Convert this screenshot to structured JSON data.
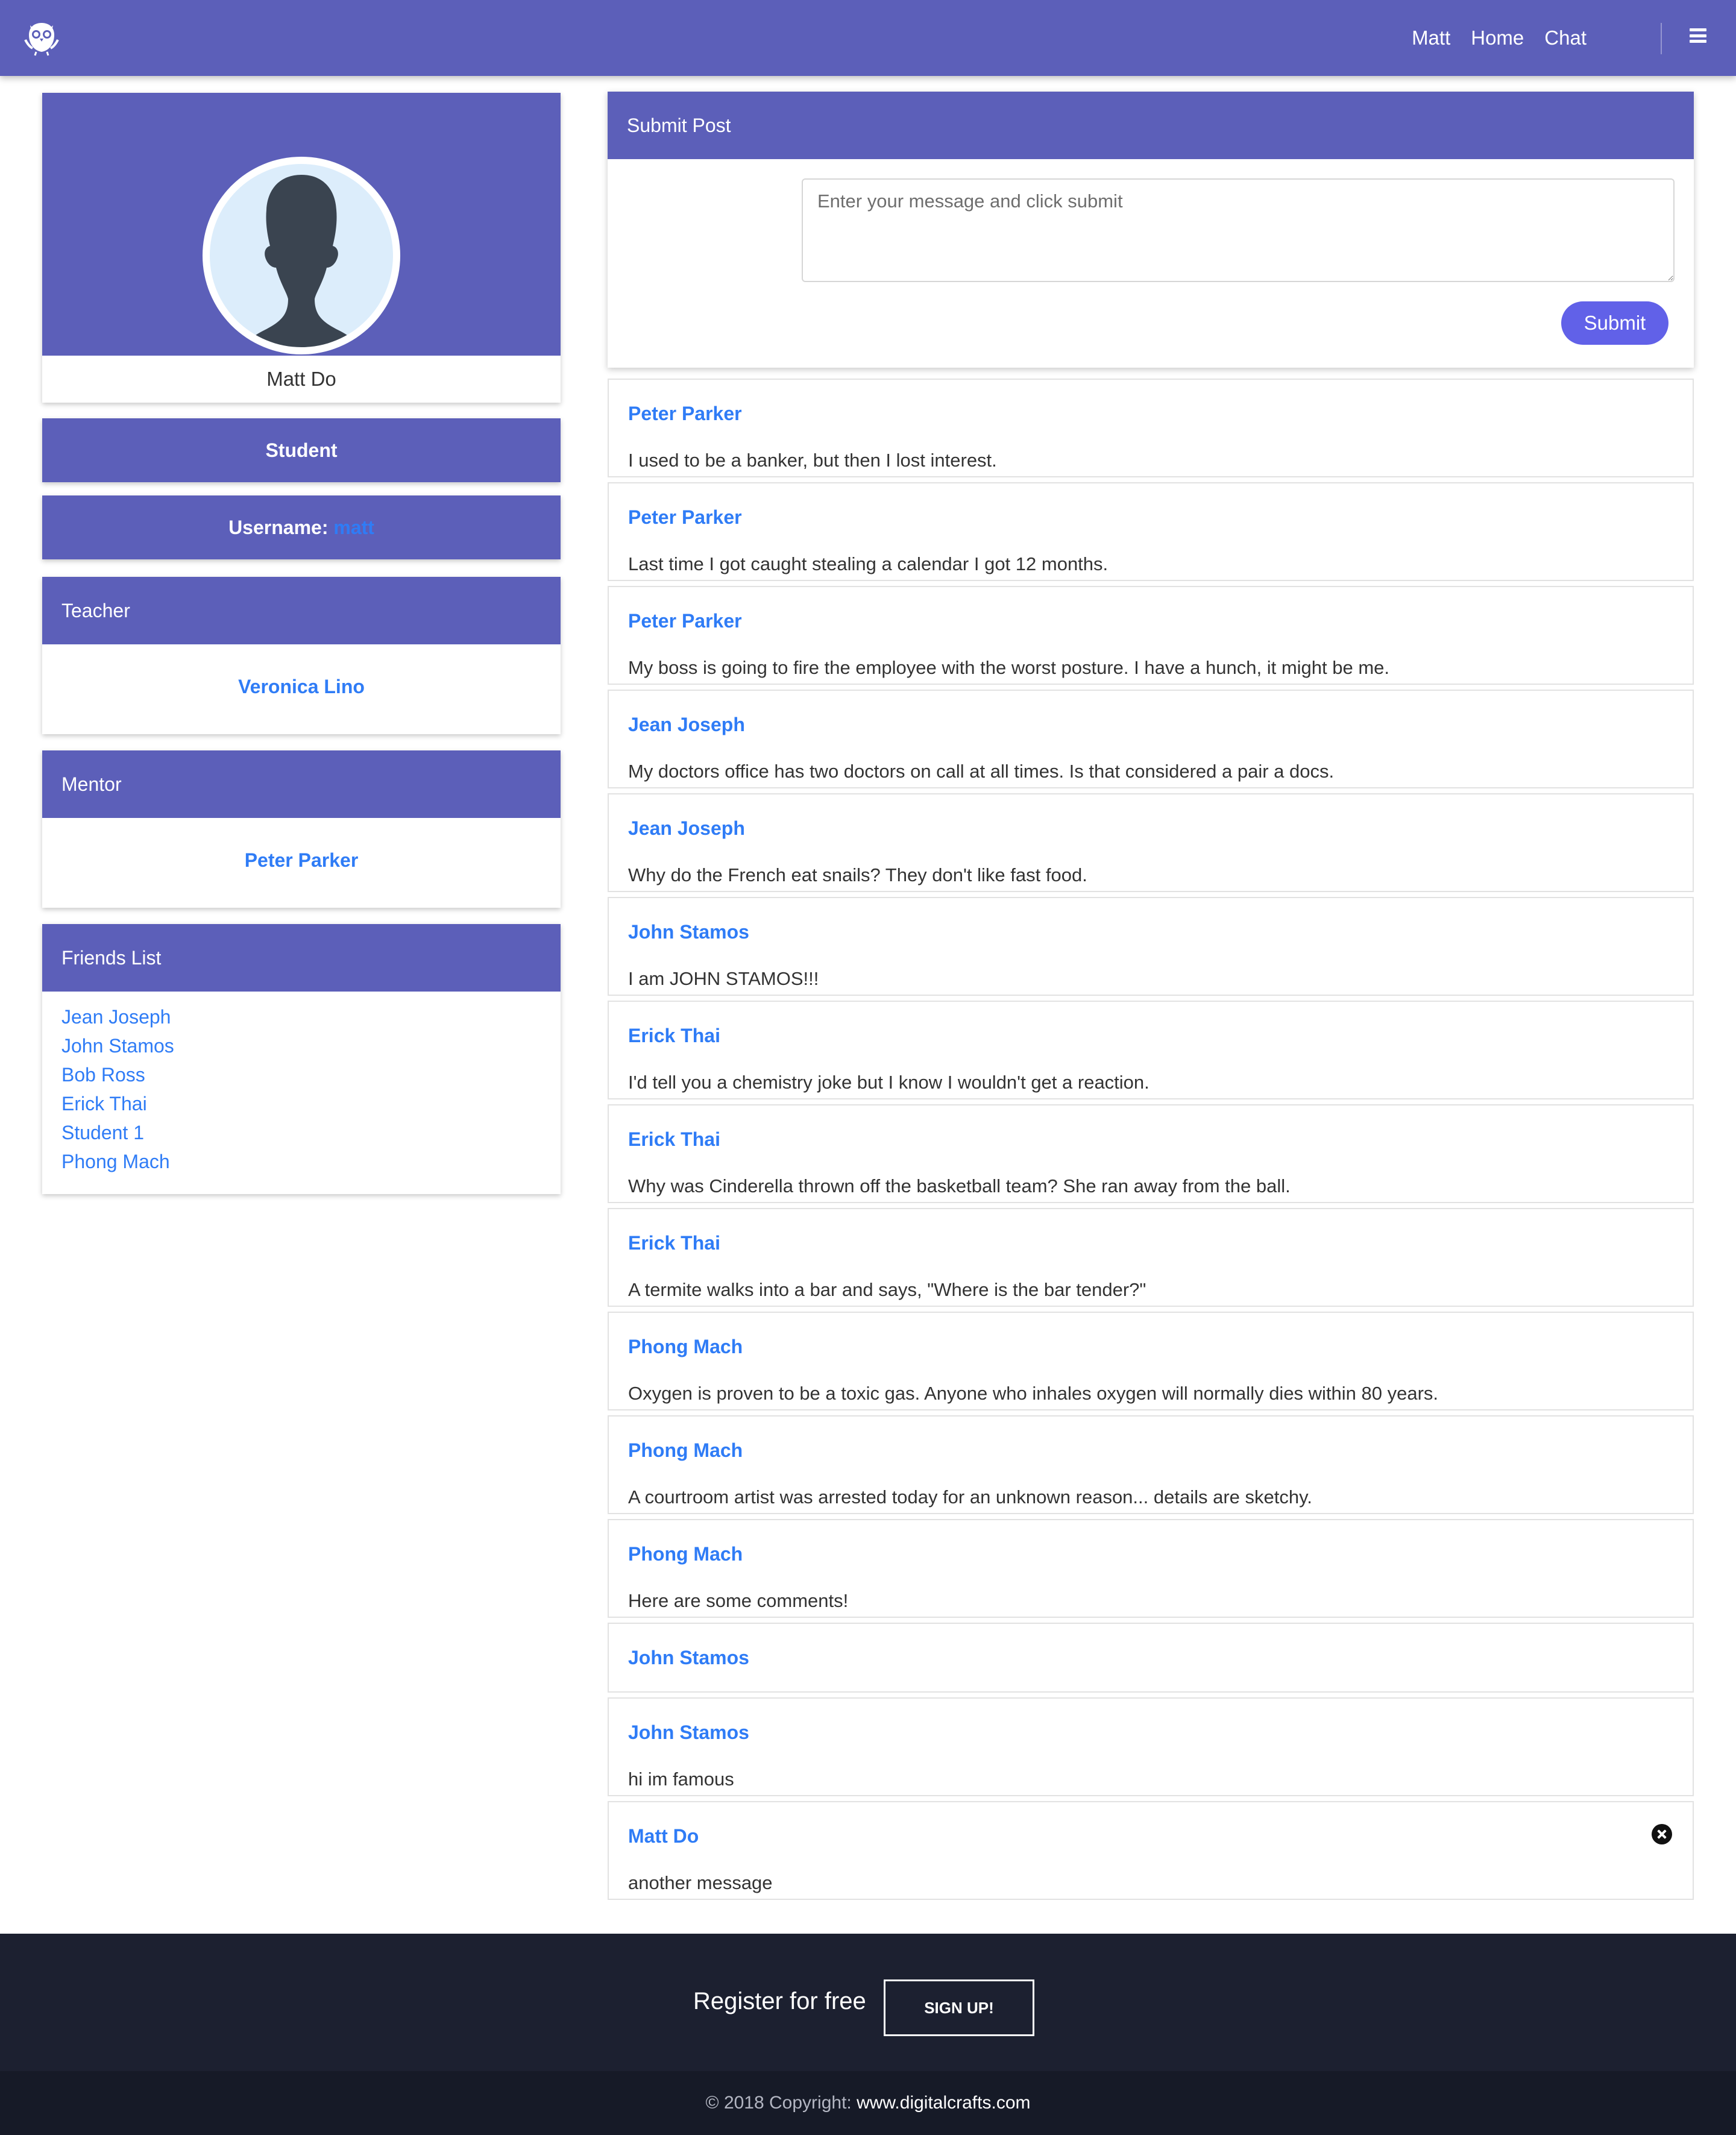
{
  "nav": {
    "logo_icon": "owl-logo-icon",
    "links": [
      "Matt",
      "Home",
      "Chat"
    ],
    "menu_icon": "hamburger-menu-icon"
  },
  "profile": {
    "name": "Matt Do",
    "role": "Student",
    "username_label": "Username:",
    "username": "matt",
    "avatar_icon": "person-silhouette-icon"
  },
  "teacher": {
    "heading": "Teacher",
    "name": "Veronica Lino"
  },
  "mentor": {
    "heading": "Mentor",
    "name": "Peter Parker"
  },
  "friends": {
    "heading": "Friends List",
    "items": [
      "Jean Joseph",
      "John Stamos",
      "Bob Ross",
      "Erick Thai",
      "Student 1",
      "Phong Mach"
    ]
  },
  "submit_post": {
    "heading": "Submit Post",
    "placeholder": "Enter your message and click submit",
    "button_label": "Submit"
  },
  "posts": [
    {
      "author": "Peter Parker",
      "text": "I used to be a banker, but then I lost interest."
    },
    {
      "author": "Peter Parker",
      "text": "Last time I got caught stealing a calendar I got 12 months."
    },
    {
      "author": "Peter Parker",
      "text": "My boss is going to fire the employee with the worst posture. I have a hunch, it might be me."
    },
    {
      "author": "Jean Joseph",
      "text": "My doctors office has two doctors on call at all times. Is that considered a pair a docs."
    },
    {
      "author": "Jean Joseph",
      "text": "Why do the French eat snails? They don't like fast food."
    },
    {
      "author": "John Stamos",
      "text": "I am JOHN STAMOS!!!"
    },
    {
      "author": "Erick Thai",
      "text": "I'd tell you a chemistry joke but I know I wouldn't get a reaction."
    },
    {
      "author": "Erick Thai",
      "text": "Why was Cinderella thrown off the basketball team? She ran away from the ball."
    },
    {
      "author": "Erick Thai",
      "text": "A termite walks into a bar and says, \"Where is the bar tender?\""
    },
    {
      "author": "Phong Mach",
      "text": "Oxygen is proven to be a toxic gas. Anyone who inhales oxygen will normally dies within 80 years."
    },
    {
      "author": "Phong Mach",
      "text": "A courtroom artist was arrested today for an unknown reason... details are sketchy."
    },
    {
      "author": "Phong Mach",
      "text": "Here are some comments!"
    },
    {
      "author": "John Stamos",
      "text": ""
    },
    {
      "author": "John Stamos",
      "text": "hi im famous"
    },
    {
      "author": "Matt Do",
      "text": "another message",
      "delete_icon": "close-circle-icon"
    }
  ],
  "footer": {
    "register_text": "Register for free",
    "signup_label": "SIGN UP!",
    "copyright_text": "© 2018 Copyright: ",
    "copyright_link": "www.digitalcrafts.com"
  },
  "colors": {
    "primary": "#5c5fb9",
    "link": "#2f7cf6",
    "button": "#6161e8",
    "footer_top": "#1c2030",
    "footer_bottom": "#161a27"
  }
}
